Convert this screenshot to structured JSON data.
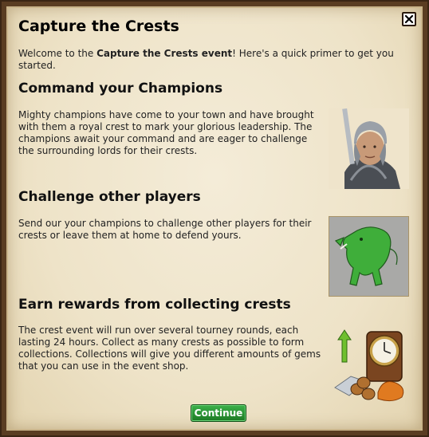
{
  "dialog": {
    "title": "Capture the Crests",
    "intro_start": "Welcome to the ",
    "intro_bold": "Capture the Crests event",
    "intro_end": "! Here's a quick primer to get you started.",
    "close_label": "Close"
  },
  "sections": [
    {
      "heading": "Command your Champions",
      "body": "Mighty champions have come to your town and have brought with them a royal crest to mark your glorious leadership. The champions await your command and are eager to challenge the surrounding lords for their crests.",
      "image_icon": "knight-portrait"
    },
    {
      "heading": "Challenge other players",
      "body": "Send our your champions to challenge other players for their crests or leave them at home to defend yours.",
      "image_icon": "boar-crest"
    },
    {
      "heading": "Earn rewards from collecting crests",
      "body": "The crest event will run over several tourney rounds, each lasting 24 hours. Collect as many crests as possible to form collections. Collections will give you different amounts of gems that you can use in the event shop.",
      "image_icon": "clock-and-resources"
    }
  ],
  "continue_label": "Continue"
}
